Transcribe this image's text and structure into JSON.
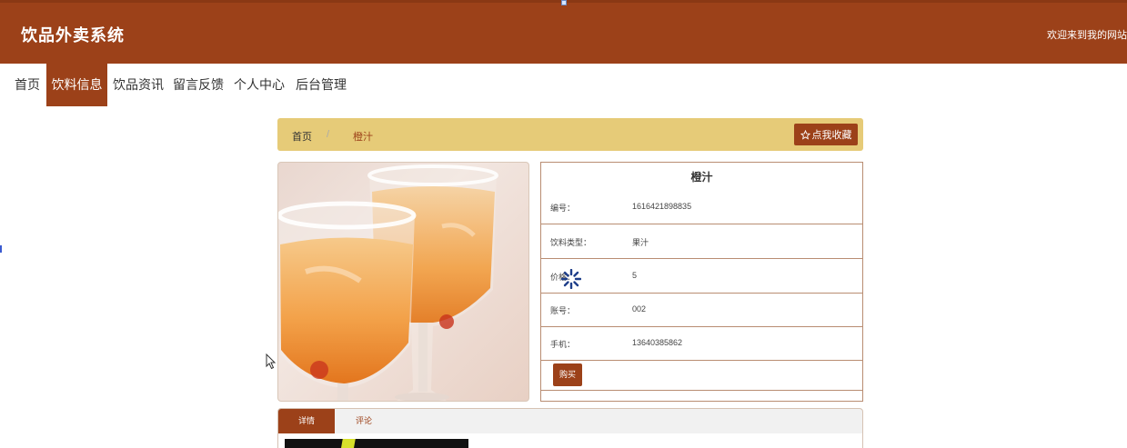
{
  "header": {
    "brand": "饮品外卖系统",
    "welcome": "欢迎来到我的网站"
  },
  "nav": {
    "items": [
      {
        "label": "首页",
        "active": false
      },
      {
        "label": "饮料信息",
        "active": true
      },
      {
        "label": "饮品资讯",
        "active": false
      },
      {
        "label": "留言反馈",
        "active": false
      },
      {
        "label": "个人中心",
        "active": false
      },
      {
        "label": "后台管理",
        "active": false
      }
    ]
  },
  "breadcrumb": {
    "home": "首页",
    "separator": "/",
    "current": "橙汁",
    "favorite_label": "点我收藏",
    "favorite_icon": "star-outline-icon"
  },
  "product": {
    "title": "橙汁",
    "image_alt": "橙汁",
    "rows": [
      {
        "label": "编号：",
        "value": "1616421898835"
      },
      {
        "label": "饮料类型：",
        "value": "果汁"
      },
      {
        "label": "价格：",
        "value": "5"
      },
      {
        "label": "账号：",
        "value": "002"
      },
      {
        "label": "手机：",
        "value": "13640385862"
      }
    ],
    "buy_label": "购买"
  },
  "tabs": {
    "items": [
      {
        "label": "详情",
        "active": true
      },
      {
        "label": "评论",
        "active": false
      }
    ]
  },
  "colors": {
    "primary": "#9c4119",
    "breadcrumb_bg": "#e6cb78",
    "border": "#b98d72"
  }
}
